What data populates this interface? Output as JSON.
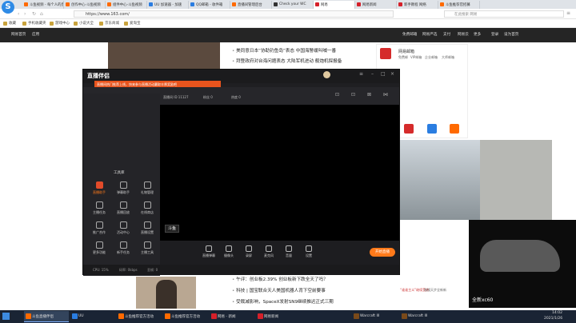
{
  "browser": {
    "tabs": [
      {
        "label": "斗鱼视频 - 每个人的直",
        "color": "#ff6a00"
      },
      {
        "label": "创作中心-斗鱼视频",
        "color": "#ff6a00"
      },
      {
        "label": "组件中心-斗鱼视频",
        "color": "#ff6a00"
      },
      {
        "label": "UU 加速器 - 加速",
        "color": "#2a7de1"
      },
      {
        "label": "QQ邮箱 - 收件箱",
        "color": "#2a7de1"
      },
      {
        "label": "直播间管理后台",
        "color": "#ff6a00"
      },
      {
        "label": "Check your WC",
        "color": "#333333"
      },
      {
        "label": "网易",
        "color": "#d5202a"
      },
      {
        "label": "网易新闻",
        "color": "#d5202a"
      },
      {
        "label": "新手教程 网络",
        "color": "#d5202a"
      },
      {
        "label": "斗鱼推荐官招募",
        "color": "#ff6a00"
      }
    ],
    "url": "https://www.163.com/",
    "search_placeholder": "在此搜索 网易",
    "bookmarks": [
      "收藏",
      "手机收藏夹",
      "游戏中心",
      "小说大全",
      "京东商城",
      "爱淘宝"
    ]
  },
  "site": {
    "header_left": [
      "网易首页",
      "应用"
    ],
    "header_right": [
      "免费邮箱",
      "网易严选",
      "支付",
      "网易云",
      "更多",
      "登录",
      "设为首页"
    ],
    "news": [
      "美同意日本“协助钓鱼岛”表态 中国海警缓叫喊一番",
      "拜登政府对台海问题表态 大陆军机进动 舰炮机探报备",
      "午评：创业板2.39% 创业板新下跌全天了吗？",
      "科技 | 国宝联合天人美国机器人背下空前要事",
      "受裁减影响，SpaceX发射SN9继续推迟正式三期"
    ],
    "right_panel": {
      "title": "网易邮箱",
      "links": [
        "免费邮",
        "VIP邮箱",
        "企业邮箱",
        "大师邮箱"
      ],
      "ad_caption": "全新xc60",
      "promo": [
        "“谁谁主义”继续受热",
        "和搜天步全新新"
      ]
    }
  },
  "app": {
    "brand": "直播伴侣",
    "notice": "直播间热门推荐上线，快来参与直播活动赢取丰厚奖励吧",
    "top_info": [
      "直播间 ID 11127",
      "粉丝 0",
      "热度 0"
    ],
    "stream_label": "斗鱼直播",
    "tools_title": "工具库",
    "tools": [
      "直播助手",
      "弹幕助手",
      "礼物管理",
      "主播任务",
      "直播回放",
      "在线商店",
      "推广合作",
      "活动中心",
      "直播设置",
      "更多功能",
      "新手任务",
      "主播工具"
    ],
    "controls": [
      "直播弹幕",
      "摄像头",
      "录屏",
      "麦克风",
      "音量",
      "设置"
    ],
    "go_live": "开始直播",
    "status": [
      "CPU: 15%",
      "码率: 0kbps",
      "丢帧: 0"
    ]
  },
  "taskbar": {
    "items": [
      "斗鱼直播伴侣",
      "UU",
      "斗鱼推荐官方活动",
      "斗鱼推荐官方活动",
      "网易 - 新闻",
      "网易新闻",
      "Warcraft III",
      "Warcraft III"
    ],
    "time": "14:02",
    "date": "2021/1/26"
  }
}
